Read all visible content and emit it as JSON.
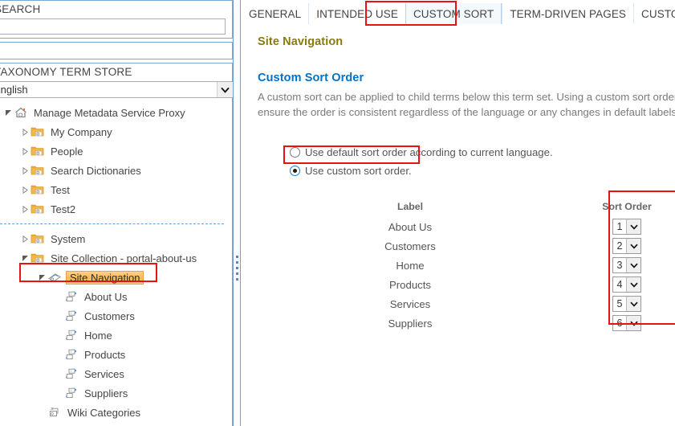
{
  "left": {
    "search": {
      "caption": "SEARCH",
      "value": "",
      "placeholder": ""
    },
    "termstore": {
      "caption": "TAXONOMY TERM STORE",
      "language_selected": "English"
    },
    "tree": [
      {
        "label": "Manage Metadata Service Proxy",
        "icon": "home-icon",
        "indent": 0,
        "twist": "expanded"
      },
      {
        "label": "My Company",
        "icon": "group-icon",
        "indent": 1,
        "twist": "collapsed"
      },
      {
        "label": "People",
        "icon": "group-icon",
        "indent": 1,
        "twist": "collapsed"
      },
      {
        "label": "Search Dictionaries",
        "icon": "group-icon",
        "indent": 1,
        "twist": "collapsed"
      },
      {
        "label": "Test",
        "icon": "group-icon",
        "indent": 1,
        "twist": "collapsed"
      },
      {
        "label": "Test2",
        "icon": "group-icon",
        "indent": 1,
        "twist": "collapsed"
      },
      {
        "separator": true
      },
      {
        "label": "System",
        "icon": "group-icon",
        "indent": 1,
        "twist": "collapsed"
      },
      {
        "label": "Site Collection - portal-about-us",
        "icon": "group-icon",
        "indent": 1,
        "twist": "expanded"
      },
      {
        "label": "Site Navigation",
        "icon": "termset-icon",
        "indent": 2,
        "twist": "expanded",
        "selected": true
      },
      {
        "label": "About Us",
        "icon": "term-icon",
        "indent": 3,
        "twist": "none"
      },
      {
        "label": "Customers",
        "icon": "term-icon",
        "indent": 3,
        "twist": "none"
      },
      {
        "label": "Home",
        "icon": "term-icon",
        "indent": 3,
        "twist": "none"
      },
      {
        "label": "Products",
        "icon": "term-icon",
        "indent": 3,
        "twist": "none"
      },
      {
        "label": "Services",
        "icon": "term-icon",
        "indent": 3,
        "twist": "none"
      },
      {
        "label": "Suppliers",
        "icon": "term-icon",
        "indent": 3,
        "twist": "none"
      },
      {
        "label": "Wiki Categories",
        "icon": "wiki-icon",
        "indent": 2,
        "twist": "none"
      }
    ]
  },
  "right": {
    "tabs": [
      {
        "label": "GENERAL",
        "active": false
      },
      {
        "label": "INTENDED USE",
        "active": false
      },
      {
        "label": "CUSTOM SORT",
        "active": true
      },
      {
        "label": "TERM-DRIVEN PAGES",
        "active": false
      },
      {
        "label": "CUSTOM PROPERTIES",
        "active": false
      }
    ],
    "page_title": "Site Navigation",
    "section_title": "Custom Sort Order",
    "section_desc": "A custom sort can be applied to child terms below this term set. Using a custom sort order will ensure the order is consistent regardless of the language or any changes in default labels.",
    "radios": [
      {
        "label": "Use default sort order according to current language.",
        "selected": false
      },
      {
        "label": "Use custom sort order.",
        "selected": true
      }
    ],
    "table": {
      "headers": {
        "label": "Label",
        "order": "Sort Order"
      },
      "rows": [
        {
          "label": "About Us",
          "order": "1"
        },
        {
          "label": "Customers",
          "order": "2"
        },
        {
          "label": "Home",
          "order": "3"
        },
        {
          "label": "Products",
          "order": "4"
        },
        {
          "label": "Services",
          "order": "5"
        },
        {
          "label": "Suppliers",
          "order": "6"
        }
      ]
    }
  },
  "annotations": {
    "tab_highlight": "CUSTOM SORT",
    "radio_highlight": "Use custom sort order.",
    "tree_highlight": "Site Navigation",
    "column_highlight": "Sort Order",
    "color": "#e81212"
  }
}
